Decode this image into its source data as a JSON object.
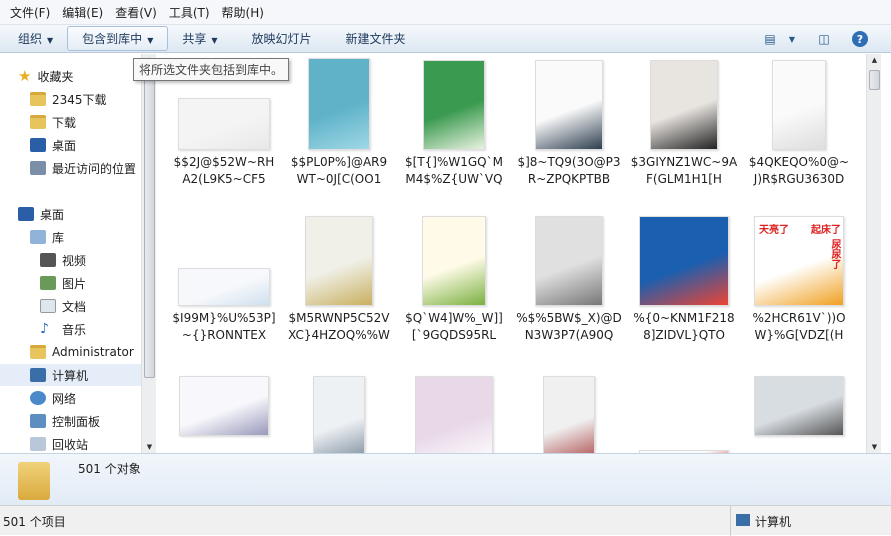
{
  "menu": [
    "文件(F)",
    "编辑(E)",
    "查看(V)",
    "工具(T)",
    "帮助(H)"
  ],
  "toolbar": {
    "organize": "组织",
    "include_library": "包含到库中",
    "share": "共享",
    "slideshow": "放映幻灯片",
    "new_folder": "新建文件夹"
  },
  "tooltip": "将所选文件夹包括到库中。",
  "nav": {
    "favorites": "收藏夹",
    "fav_items": [
      "2345下载",
      "下载",
      "桌面",
      "最近访问的位置"
    ],
    "desktop": "桌面",
    "library": "库",
    "lib_items": [
      "视频",
      "图片",
      "文档",
      "音乐"
    ],
    "admin": "Administrator",
    "computer": "计算机",
    "network": "网络",
    "control_panel": "控制面板",
    "recycle": "回收站"
  },
  "files": [
    "$$2J@$52W~RHA2(L9K5~CF5",
    "$$PL0P%]@AR9WT~0J[C(OO1",
    "$[T{]%W1GQ`MM4$%Z{UW`VQ",
    "$]8~TQ9(3O@P3R~ZPQKPTBB",
    "$3GIYNZ1WC~9AF(GLM1H1[H",
    "$4QKEQO%0@~J)R$RGU3630D",
    "$I99M}%U%53P]~{}RONNTEX",
    "$M5RWNP5C52VXC}4HZOQ%%W",
    "$Q`W4]W%_W]][`9GQDS95RL",
    "%$%5BW$_X)@DN3W3P7(A90Q",
    "%{0~KNM1F2188]ZIDVL}QTO",
    "%2HCR61V`))OW}%G[VDZ[(H",
    "",
    "",
    "",
    "",
    "",
    ""
  ],
  "thumb_texts": {
    "rooster_1": "天亮了",
    "rooster_2": "起床了",
    "rooster_3": "尿尿了"
  },
  "details": {
    "count": "501 个对象"
  },
  "status": {
    "items": "501 个项目",
    "location": "计算机"
  }
}
